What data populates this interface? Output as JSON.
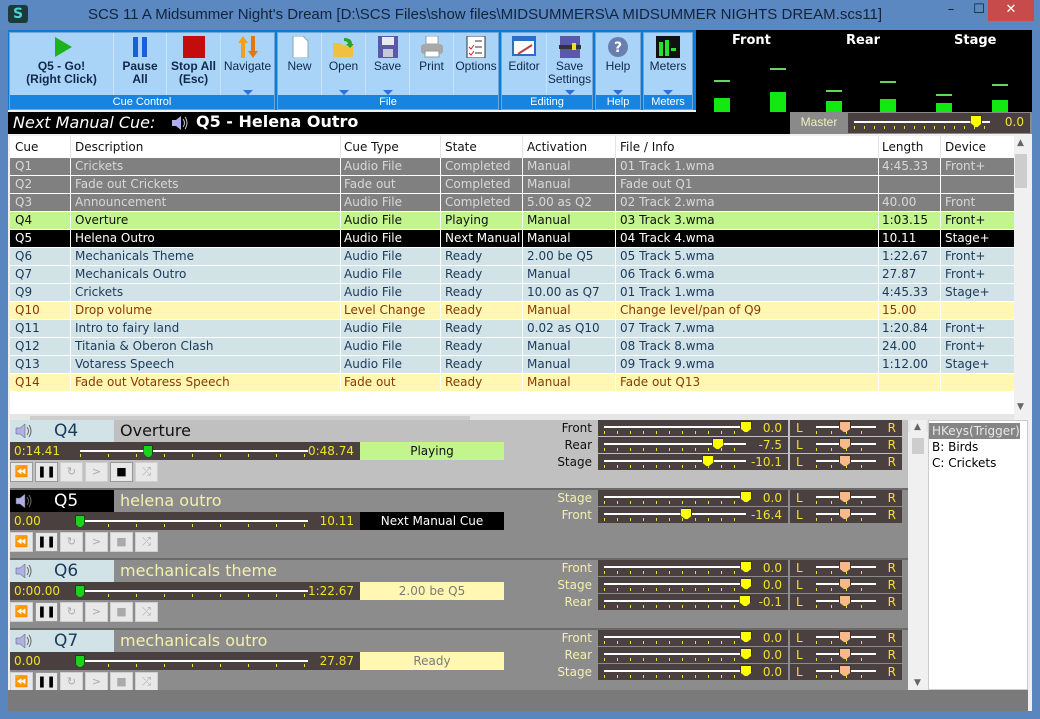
{
  "window": {
    "title": "SCS 11  A Midsummer Night's Dream [D:\\SCS Files\\show files\\MIDSUMMERS\\A MIDSUMMER NIGHTS DREAM.scs11]",
    "app_icon": "scs-logo-icon",
    "minimize": "–",
    "maximize": "☐",
    "close": "✕"
  },
  "ribbon": {
    "groups": [
      {
        "label": "Cue Control"
      },
      {
        "label": "File"
      },
      {
        "label": "Editing"
      },
      {
        "label": "Help"
      },
      {
        "label": "Meters"
      }
    ],
    "buttons": {
      "go": {
        "line1": "Q5 - Go!",
        "line2": "(Right Click)",
        "icon": "play-icon"
      },
      "pause": {
        "line1": "Pause",
        "line2": "All",
        "icon": "pause-icon"
      },
      "stop": {
        "line1": "Stop All",
        "line2": "(Esc)",
        "icon": "stop-icon"
      },
      "navigate": {
        "line1": "Navigate",
        "icon": "navigate-arrows-icon"
      },
      "new": {
        "line1": "New",
        "icon": "new-document-icon"
      },
      "open": {
        "line1": "Open",
        "icon": "open-folder-icon"
      },
      "save": {
        "line1": "Save",
        "icon": "floppy-disk-icon"
      },
      "print": {
        "line1": "Print",
        "icon": "printer-icon"
      },
      "options": {
        "line1": "Options",
        "icon": "checklist-icon"
      },
      "editor": {
        "line1": "Editor",
        "icon": "editor-icon"
      },
      "save_settings": {
        "line1": "Save",
        "line2": "Settings",
        "icon": "save-settings-icon"
      },
      "help": {
        "line1": "Help",
        "icon": "help-icon"
      },
      "meters": {
        "line1": "Meters",
        "icon": "meters-icon"
      }
    }
  },
  "meters": {
    "labels": [
      "Front",
      "Rear",
      "Stage"
    ],
    "channels": [
      {
        "level": 0.24,
        "peak": 0.5
      },
      {
        "level": 0.34,
        "peak": 0.7
      },
      {
        "level": 0.18,
        "peak": 0.33
      },
      {
        "level": 0.22,
        "peak": 0.48
      },
      {
        "level": 0.15,
        "peak": 0.27
      },
      {
        "level": 0.2,
        "peak": 0.43
      }
    ],
    "color": "#12e812"
  },
  "next_manual_cue": {
    "label": "Next Manual Cue:",
    "value": "Q5 - Helena Outro"
  },
  "master": {
    "label": "Master",
    "value": "0.0",
    "fraction": 0.9
  },
  "cue_table": {
    "columns": [
      "Cue",
      "Description",
      "Cue Type",
      "State",
      "Activation",
      "File / Info",
      "Length",
      "Device"
    ],
    "rows": [
      {
        "cells": [
          "Q1",
          "Crickets",
          "Audio File",
          "Completed",
          "Manual",
          "01 Track 1.wma",
          "4:45.33",
          "Front+"
        ],
        "style": "completed"
      },
      {
        "cells": [
          "Q2",
          "Fade out Crickets",
          "Fade out",
          "Completed",
          "Manual",
          "Fade out Q1",
          "",
          ""
        ],
        "style": "completed"
      },
      {
        "cells": [
          "Q3",
          "Announcement",
          "Audio File",
          "Completed",
          "5.00 as Q2",
          "02 Track 2.wma",
          "40.00",
          "Front"
        ],
        "style": "completed"
      },
      {
        "cells": [
          "Q4",
          "Overture",
          "Audio File",
          "Playing",
          "Manual",
          "03 Track 3.wma",
          "1:03.15",
          "Front+"
        ],
        "style": "playing"
      },
      {
        "cells": [
          "Q5",
          "Helena Outro",
          "Audio File",
          "Next Manual",
          "Manual",
          "04 Track 4.wma",
          "10.11",
          "Stage+"
        ],
        "style": "next"
      },
      {
        "cells": [
          "Q6",
          "Mechanicals Theme",
          "Audio File",
          "Ready",
          "2.00 be Q5",
          "05 Track 5.wma",
          "1:22.67",
          "Front+"
        ],
        "style": "ready"
      },
      {
        "cells": [
          "Q7",
          "Mechanicals Outro",
          "Audio File",
          "Ready",
          "Manual",
          "06 Track 6.wma",
          "27.87",
          "Front+"
        ],
        "style": "ready"
      },
      {
        "cells": [
          "Q9",
          "Crickets",
          "Audio File",
          "Ready",
          "10.00 as Q7",
          "01 Track 1.wma",
          "4:45.33",
          "Stage+"
        ],
        "style": "ready"
      },
      {
        "cells": [
          "Q10",
          "Drop volume",
          "Level Change",
          "Ready",
          "Manual",
          "Change level/pan of Q9",
          "15.00",
          ""
        ],
        "style": "yellow"
      },
      {
        "cells": [
          "Q11",
          "Intro to fairy land",
          "Audio File",
          "Ready",
          "0.02 as Q10",
          "07 Track 7.wma",
          "1:20.84",
          "Front+"
        ],
        "style": "ready"
      },
      {
        "cells": [
          "Q12",
          "Titania & Oberon Clash",
          "Audio File",
          "Ready",
          "Manual",
          "08 Track 8.wma",
          "24.00",
          "Front+"
        ],
        "style": "ready"
      },
      {
        "cells": [
          "Q13",
          "Votaress Speech",
          "Audio File",
          "Ready",
          "Manual",
          "09 Track 9.wma",
          "1:12.00",
          "Stage+"
        ],
        "style": "ready"
      },
      {
        "cells": [
          "Q14",
          "Fade out Votaress Speech",
          "Fade out",
          "Ready",
          "Manual",
          "Fade out Q13",
          "",
          ""
        ],
        "style": "yellow"
      }
    ]
  },
  "cue_panels": [
    {
      "cue": "Q4",
      "description": "Overture",
      "start": "0:14.41",
      "end": "0:48.74",
      "progress": 0.3,
      "state": "Playing",
      "style": "playing",
      "controls_enabled": [
        true,
        true,
        false,
        false,
        true,
        false
      ],
      "levels": [
        {
          "device": "Front",
          "value": "0.0",
          "fraction": 1.0,
          "pan_left": "L",
          "pan_right": "R"
        },
        {
          "device": "Rear",
          "value": "-7.5",
          "fraction": 0.8,
          "pan_left": "L",
          "pan_right": "R"
        },
        {
          "device": "Stage",
          "value": "-10.1",
          "fraction": 0.73,
          "pan_left": "L",
          "pan_right": "R"
        }
      ]
    },
    {
      "cue": "Q5",
      "description": "helena outro",
      "start": "0.00",
      "end": "10.11",
      "progress": 0.0,
      "state": "Next Manual Cue",
      "style": "next",
      "controls_enabled": [
        false,
        true,
        false,
        false,
        false,
        false
      ],
      "levels": [
        {
          "device": "Stage",
          "value": "0.0",
          "fraction": 1.0,
          "pan_left": "L",
          "pan_right": "R"
        },
        {
          "device": "Front",
          "value": "-16.4",
          "fraction": 0.58,
          "pan_left": "L",
          "pan_right": "R"
        }
      ]
    },
    {
      "cue": "Q6",
      "description": "mechanicals theme",
      "start": "0:00.00",
      "end": "1:22.67",
      "progress": 0.0,
      "state": "2.00 be Q5",
      "style": "ready",
      "controls_enabled": [
        false,
        true,
        false,
        false,
        false,
        false
      ],
      "levels": [
        {
          "device": "Front",
          "value": "0.0",
          "fraction": 1.0,
          "pan_left": "L",
          "pan_right": "R"
        },
        {
          "device": "Stage",
          "value": "0.0",
          "fraction": 1.0,
          "pan_left": "L",
          "pan_right": "R"
        },
        {
          "device": "Rear",
          "value": "-0.1",
          "fraction": 0.995,
          "pan_left": "L",
          "pan_right": "R"
        }
      ]
    },
    {
      "cue": "Q7",
      "description": "mechanicals outro",
      "start": "0.00",
      "end": "27.87",
      "progress": 0.0,
      "state": "Ready",
      "style": "ready",
      "controls_enabled": [
        false,
        true,
        false,
        false,
        false,
        false
      ],
      "levels": [
        {
          "device": "Front",
          "value": "0.0",
          "fraction": 1.0,
          "pan_left": "L",
          "pan_right": "R"
        },
        {
          "device": "Rear",
          "value": "0.0",
          "fraction": 1.0,
          "pan_left": "L",
          "pan_right": "R"
        },
        {
          "device": "Stage",
          "value": "0.0",
          "fraction": 1.0,
          "pan_left": "L",
          "pan_right": "R"
        }
      ]
    }
  ],
  "control_icons": [
    "rewind-icon",
    "play-pause-icon",
    "loop-icon",
    "next-icon",
    "stop-icon",
    "shuffle-icon"
  ],
  "hotkeys": {
    "header": "HKeys(Trigger)",
    "items": [
      "B: Birds",
      "C: Crickets"
    ]
  },
  "colors": {
    "completed_bg": "#808080",
    "completed_fg": "#d8d8d8",
    "playing_bg": "#c2f58d",
    "playing_fg": "#111111",
    "next_bg": "#000000",
    "next_fg": "#ffffff",
    "ready_bg": "#d2e3e8",
    "ready_fg": "#1a3a5a",
    "yellow_bg": "#fff7b2",
    "yellow_fg": "#8a3a00"
  }
}
